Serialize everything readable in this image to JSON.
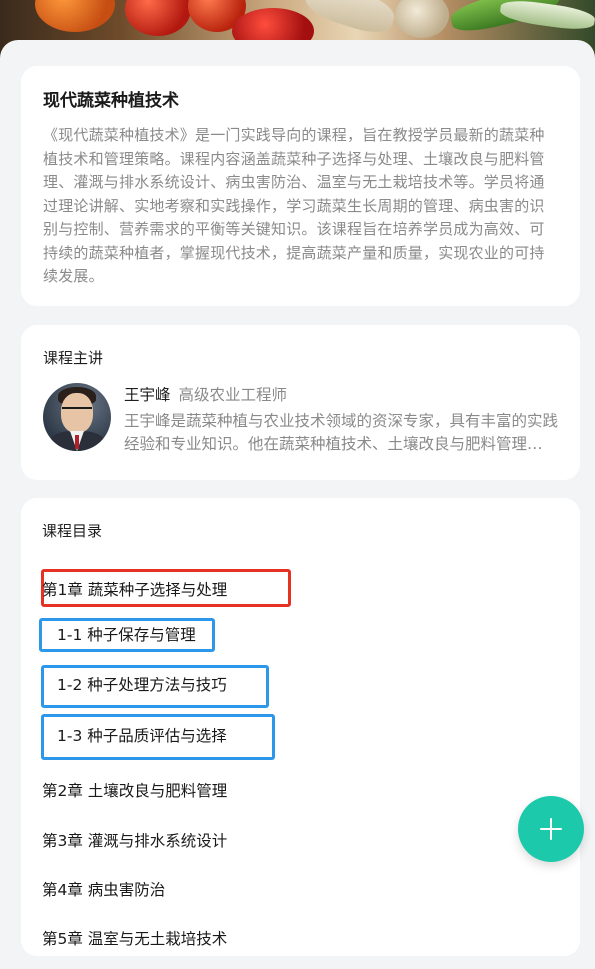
{
  "course": {
    "title": "现代蔬菜种植技术",
    "description": "《现代蔬菜种植技术》是一门实践导向的课程，旨在教授学员最新的蔬菜种植技术和管理策略。课程内容涵盖蔬菜种子选择与处理、土壤改良与肥料管理、灌溉与排水系统设计、病虫害防治、温室与无土栽培技术等。学员将通过理论讲解、实地考察和实践操作，学习蔬菜生长周期的管理、病虫害的识别与控制、营养需求的平衡等关键知识。该课程旨在培养学员成为高效、可持续的蔬菜种植者，掌握现代技术，提高蔬菜产量和质量，实现农业的可持续发展。"
  },
  "lecturer": {
    "section_label": "课程主讲",
    "name": "王宇峰",
    "title": "高级农业工程师",
    "bio": "王宇峰是蔬菜种植与农业技术领域的资深专家，具有丰富的实践经验和专业知识。他在蔬菜种植技术、土壤改良与肥料管理、病虫害防治等方面有深入研究。"
  },
  "catalog": {
    "section_label": "课程目录",
    "chapters": [
      {
        "label": "第1章 蔬菜种子选择与处理",
        "sections": [
          {
            "label": "1-1 种子保存与管理"
          },
          {
            "label": "1-2 种子处理方法与技巧"
          },
          {
            "label": "1-3 种子品质评估与选择"
          }
        ]
      },
      {
        "label": "第2章 土壤改良与肥料管理"
      },
      {
        "label": "第3章 灌溉与排水系统设计"
      },
      {
        "label": "第4章 病虫害防治"
      },
      {
        "label": "第5章 温室与无土栽培技术"
      }
    ]
  },
  "fab": {
    "icon": "plus-icon",
    "color": "#1dc9ab"
  },
  "colors": {
    "highlight_chapter": "#e53223",
    "highlight_section": "#2d97ea"
  }
}
